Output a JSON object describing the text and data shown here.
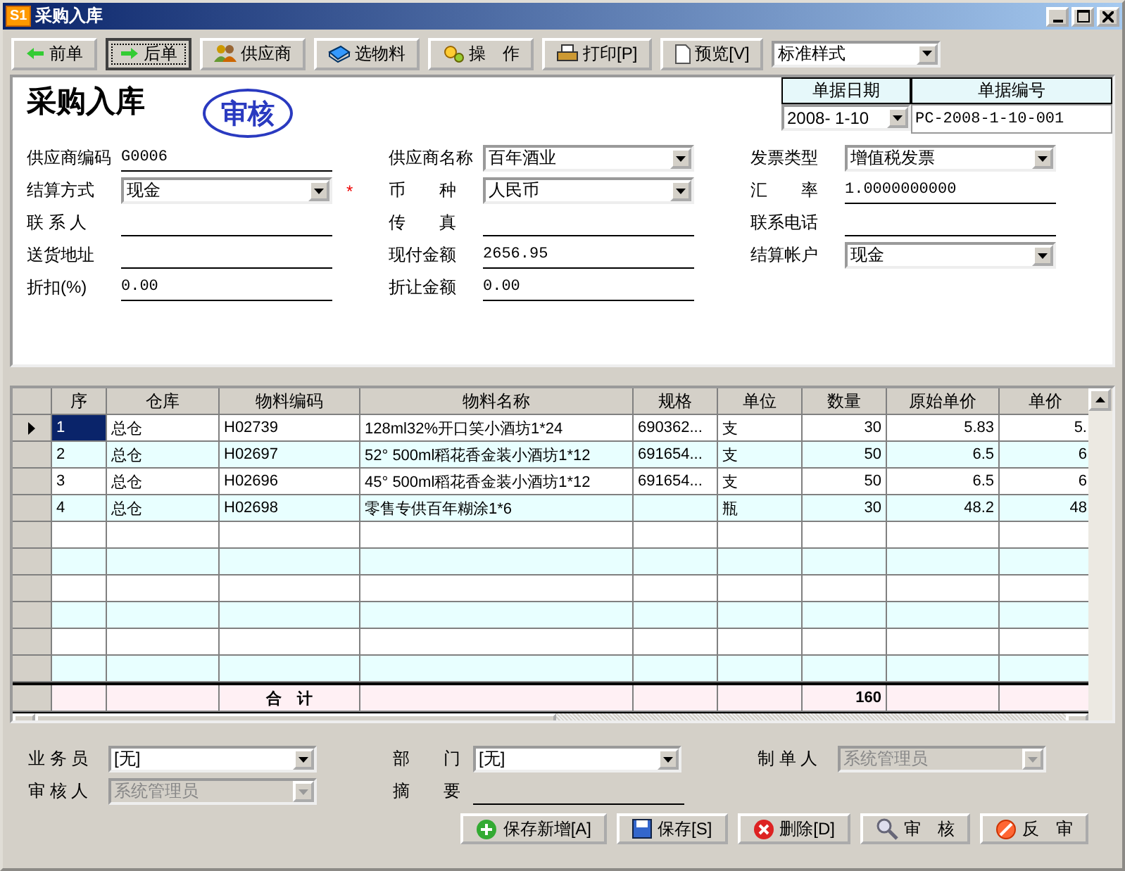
{
  "window": {
    "app_icon": "S1",
    "title": "采购入库"
  },
  "toolbar": {
    "buttons": [
      {
        "label": "前单",
        "focused": false
      },
      {
        "label": "后单",
        "focused": true
      },
      {
        "label": "供应商",
        "focused": false
      },
      {
        "label": "选物料",
        "focused": false
      },
      {
        "label": "操　作",
        "focused": false
      },
      {
        "label": "打印[P]",
        "focused": false
      },
      {
        "label": "预览[V]",
        "focused": false
      }
    ],
    "style_select": {
      "value": "标准样式"
    }
  },
  "header": {
    "title": "采购入库",
    "stamp": "审核",
    "doc_date": {
      "label": "单据日期",
      "value": "2008- 1-10"
    },
    "doc_number": {
      "label": "单据编号",
      "value": "PC-2008-1-10-001"
    },
    "columns": [
      [
        {
          "label": "供应商编码",
          "kind": "text",
          "value": "G0006"
        },
        {
          "label": "结算方式",
          "kind": "select",
          "value": "现金",
          "required_mark": "*"
        },
        {
          "label": "联 系 人",
          "kind": "text"
        },
        {
          "label": "送货地址",
          "kind": "text"
        },
        {
          "label": "折扣(%)",
          "kind": "text",
          "value": "0.00"
        }
      ],
      [
        {
          "label": "供应商名称",
          "kind": "select",
          "value": "百年酒业"
        },
        {
          "label": "币　　种",
          "kind": "select",
          "value": "人民币"
        },
        {
          "label": "传　　真",
          "kind": "text"
        },
        {
          "label": "现付金额",
          "kind": "text",
          "value": "2656.95"
        },
        {
          "label": "折让金额",
          "kind": "text",
          "value": "0.00"
        }
      ],
      [
        {
          "label": "发票类型",
          "kind": "select",
          "value": "增值税发票"
        },
        {
          "label": "汇　　率",
          "kind": "text",
          "value": "1.0000000000"
        },
        {
          "label": "联系电话",
          "kind": "text"
        },
        {
          "label": "结算帐户",
          "kind": "select",
          "value": "现金"
        }
      ]
    ]
  },
  "table": {
    "columns": [
      "序",
      "仓库",
      "物料编码",
      "物料名称",
      "规格",
      "单位",
      "数量",
      "原始单价",
      "单价"
    ],
    "rows": [
      {
        "selected": true,
        "cells": [
          "1",
          "总仓",
          "H02739",
          "128ml32%开口笑小酒坊1*24",
          "690362...",
          "支",
          "30",
          "5.83",
          "5."
        ]
      },
      {
        "selected": false,
        "cells": [
          "2",
          "总仓",
          "H02697",
          "52° 500ml稻花香金装小酒坊1*12",
          "691654...",
          "支",
          "50",
          "6.5",
          "6"
        ]
      },
      {
        "selected": false,
        "cells": [
          "3",
          "总仓",
          "H02696",
          "45° 500ml稻花香金装小酒坊1*12",
          "691654...",
          "支",
          "50",
          "6.5",
          "6"
        ]
      },
      {
        "selected": false,
        "cells": [
          "4",
          "总仓",
          "H02698",
          "零售专供百年糊涂1*6",
          "",
          "瓶",
          "30",
          "48.2",
          "48"
        ]
      }
    ],
    "total_label": "合　计",
    "total_quantity": "160"
  },
  "footer": {
    "fields": [
      {
        "label": "业 务 员",
        "kind": "select",
        "value": "[无]",
        "disabled": false
      },
      {
        "label": "审 核 人",
        "kind": "select",
        "value": "系统管理员",
        "disabled": true
      },
      {
        "label": "部　　门",
        "kind": "select",
        "value": "[无]",
        "disabled": false
      },
      {
        "label": "摘　　要",
        "kind": "text"
      },
      {
        "label": "制 单 人",
        "kind": "select",
        "value": "系统管理员",
        "disabled": true
      }
    ],
    "buttons": [
      {
        "label": "保存新增[A]"
      },
      {
        "label": "保存[S]"
      },
      {
        "label": "删除[D]"
      },
      {
        "label": "审　核"
      },
      {
        "label": "反　审"
      }
    ]
  }
}
